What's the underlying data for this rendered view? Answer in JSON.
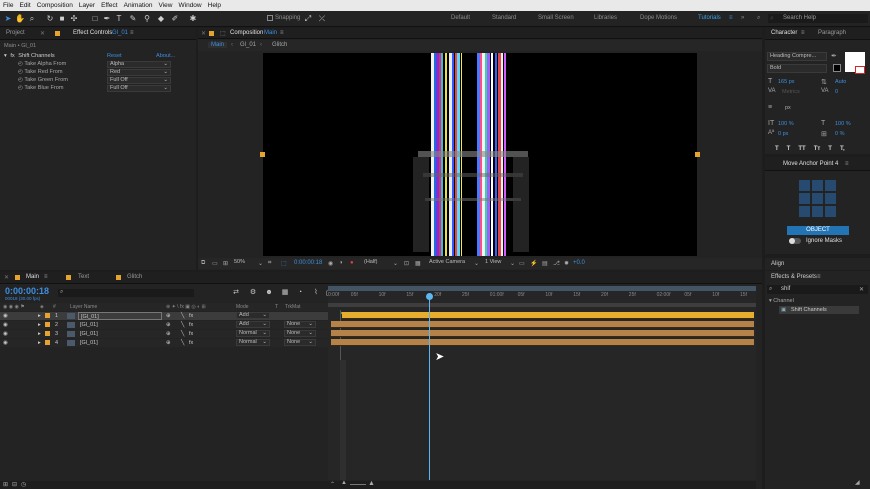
{
  "menubar": [
    "File",
    "Edit",
    "Composition",
    "Layer",
    "Effect",
    "Animation",
    "View",
    "Window",
    "Help"
  ],
  "toolbar": {
    "snapping_label": "Snapping",
    "workspaces": [
      "Default",
      "Standard",
      "Small Screen",
      "Libraries",
      "Dope Motions",
      "Tutorials"
    ],
    "active_workspace": "Tutorials",
    "search_placeholder": "Search Help"
  },
  "effect_controls": {
    "tab_project": "Project",
    "tab_label": "Effect Controls",
    "tab_layer": "Gl_01",
    "breadcrumb": "Main • Gl_01",
    "effect_name": "Shift Channels",
    "reset_label": "Reset",
    "about_label": "About...",
    "properties": [
      {
        "label": "Take Alpha From",
        "value": "Alpha"
      },
      {
        "label": "Take Red From",
        "value": "Red"
      },
      {
        "label": "Take Green From",
        "value": "Full Off"
      },
      {
        "label": "Take Blue From",
        "value": "Full Off"
      }
    ]
  },
  "composition": {
    "tab_prefix": "Composition",
    "tab_name": "Main",
    "flow_items": [
      "Main",
      "Gl_01",
      "Glitch"
    ],
    "zoom": "50%",
    "timecode": "0:00:00:18",
    "resolution": "(Half)",
    "camera": "Active Camera",
    "views": "1 View",
    "exposure": "+0.0"
  },
  "character": {
    "tab_character": "Character",
    "tab_paragraph": "Paragraph",
    "font": "Heading Compre...",
    "style": "Bold",
    "font_size": "165 px",
    "leading": "Auto",
    "kerning": "Metrics",
    "tracking": "0",
    "stroke_unit": "px",
    "vscale": "100 %",
    "hscale": "100 %",
    "baseline": "0 px",
    "tsume": "0 %",
    "styles": [
      "T",
      "T",
      "TT",
      "Tт",
      "T",
      "T,"
    ]
  },
  "anchor": {
    "title": "Move Anchor Point 4",
    "object_button": "OBJECT",
    "ignore_masks": "Ignore Masks"
  },
  "align": {
    "title": "Align"
  },
  "effects_presets": {
    "title": "Effects & Presets",
    "search_value": "shif",
    "category": "Channel",
    "result": "Shift Channels"
  },
  "timeline": {
    "tabs": [
      "Main",
      "Text",
      "Glitch"
    ],
    "timecode": "0:00:00:18",
    "fps_info": "00018 (30.00 fps)",
    "columns": {
      "layer_name": "Layer Name",
      "mode": "Mode",
      "trkmat": "TrkMat"
    },
    "ruler": [
      "0:00f",
      "05f",
      "10f",
      "15f",
      "20f",
      "25f",
      "01:00f",
      "05f",
      "10f",
      "15f",
      "20f",
      "25f",
      "02:00f",
      "05f",
      "10f",
      "15f"
    ],
    "layers": [
      {
        "num": "1",
        "name": "[Gl_01]",
        "mode": "Add",
        "trkmat": ""
      },
      {
        "num": "2",
        "name": "[Gl_01]",
        "mode": "Add",
        "trkmat": "None"
      },
      {
        "num": "3",
        "name": "[Gl_01]",
        "mode": "Normal",
        "trkmat": "None"
      },
      {
        "num": "4",
        "name": "[Gl_01]",
        "mode": "Normal",
        "trkmat": "None"
      }
    ],
    "playhead_fraction": 0.237,
    "colors": {
      "layer_bar": "#b5834a",
      "selected_bar": "#e6ad2e",
      "playhead": "#5cb7f0",
      "accent": "#3d8fdf"
    }
  }
}
